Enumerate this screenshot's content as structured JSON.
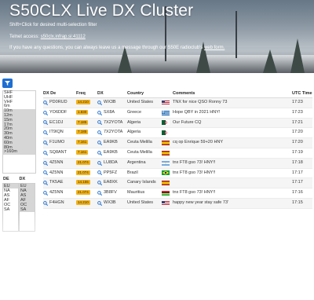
{
  "header": {
    "title": "S50CLX Live DX Cluster",
    "subtitle": "Shift+Click for desired multi-selection filter",
    "telnet_prefix": "Telnet access: ",
    "telnet_link": "s50clx.infrap.si:41112",
    "message_text": "If you have any questions, you can always leave us a message through our S50E radioclub's ",
    "message_link": "web form."
  },
  "filters": {
    "bands": [
      {
        "label": "SHF",
        "selected": false
      },
      {
        "label": "UHF",
        "selected": false
      },
      {
        "label": "VHF",
        "selected": false
      },
      {
        "label": "6m",
        "selected": false
      },
      {
        "label": "10m",
        "selected": true
      },
      {
        "label": "12m",
        "selected": true
      },
      {
        "label": "15m",
        "selected": true
      },
      {
        "label": "17m",
        "selected": true
      },
      {
        "label": "20m",
        "selected": true
      },
      {
        "label": "30m",
        "selected": true
      },
      {
        "label": "40m",
        "selected": true
      },
      {
        "label": "60m",
        "selected": true
      },
      {
        "label": "80m",
        "selected": true
      },
      {
        "label": ">160m",
        "selected": true
      }
    ],
    "de_label": "DE",
    "dx_label": "DX",
    "de_regions": [
      {
        "label": "EU",
        "selected": true
      },
      {
        "label": "NA",
        "selected": false
      },
      {
        "label": "AS",
        "selected": false
      },
      {
        "label": "AF",
        "selected": false
      },
      {
        "label": "OC",
        "selected": false
      },
      {
        "label": "SA",
        "selected": false
      }
    ],
    "dx_regions": [
      {
        "label": "EU",
        "selected": true
      },
      {
        "label": "NA",
        "selected": true
      },
      {
        "label": "AS",
        "selected": true
      },
      {
        "label": "AF",
        "selected": true
      },
      {
        "label": "OC",
        "selected": true
      },
      {
        "label": "SA",
        "selected": true
      }
    ]
  },
  "table": {
    "columns": [
      "DX De",
      "Freq",
      "DX",
      "Country",
      "Comments",
      "UTC Time"
    ],
    "rows": [
      {
        "de": "PD0RUD",
        "freq": "14.210",
        "dx": "WX3B",
        "country": "United States",
        "flag": "us",
        "comment": "TNX for nice QSO Ronny 73",
        "utc": "17:23"
      },
      {
        "de": "YO6DDF",
        "freq": "1.830",
        "dx": "SX8A",
        "country": "Greece",
        "flag": "gr",
        "comment": "Hope QBY in 2021 HNY!",
        "utc": "17:23"
      },
      {
        "de": "EC1DJ",
        "freq": "7.185",
        "dx": "7X2YOTA",
        "country": "Algeria",
        "flag": "dz",
        "comment": "Our Future CQ",
        "utc": "17:21"
      },
      {
        "de": "IT9IQN",
        "freq": "7.185",
        "dx": "7X2YOTA",
        "country": "Algeria",
        "flag": "dz",
        "comment": "",
        "utc": "17:20"
      },
      {
        "de": "F1UMO",
        "freq": "7.161",
        "dx": "EA9KB",
        "country": "Ceuta Melilla",
        "flag": "es",
        "comment": "cq op Enrique 59+20 HNY",
        "utc": "17:20"
      },
      {
        "de": "SQ8ANT",
        "freq": "7.161",
        "dx": "EA9KB",
        "country": "Ceuta Melilla",
        "flag": "es",
        "comment": "",
        "utc": "17:19"
      },
      {
        "de": "4Z5NN",
        "freq": "21.074",
        "dx": "LU8DA",
        "country": "Argentina",
        "flag": "ar",
        "comment": "tnx FT8 gso 73! HNY!!",
        "utc": "17:18"
      },
      {
        "de": "4Z5NN",
        "freq": "21.074",
        "dx": "PP5FZ",
        "country": "Brazil",
        "flag": "br",
        "comment": "tnx FT8 gso 73! HNY!!",
        "utc": "17:17"
      },
      {
        "de": "TK5AE",
        "freq": "14.155",
        "dx": "EA8XK",
        "country": "Canary Islands",
        "flag": "es",
        "comment": "",
        "utc": "17:17"
      },
      {
        "de": "4Z5NN",
        "freq": "21.074",
        "dx": "3B8FV",
        "country": "Mauritius",
        "flag": "mu",
        "comment": "tnx FT8 gso 73! HNY!!",
        "utc": "17:16"
      },
      {
        "de": "F4HGN",
        "freq": "14.210",
        "dx": "WX3B",
        "country": "United States",
        "flag": "us",
        "comment": "happy new year stay safe 73'",
        "utc": "17:15"
      }
    ]
  },
  "colors": {
    "accent": "#1f6fd1",
    "freq_badge": "#f2b41d"
  },
  "icons": {
    "filter": "funnel-icon",
    "row_lookup": "magnifier-icon"
  }
}
